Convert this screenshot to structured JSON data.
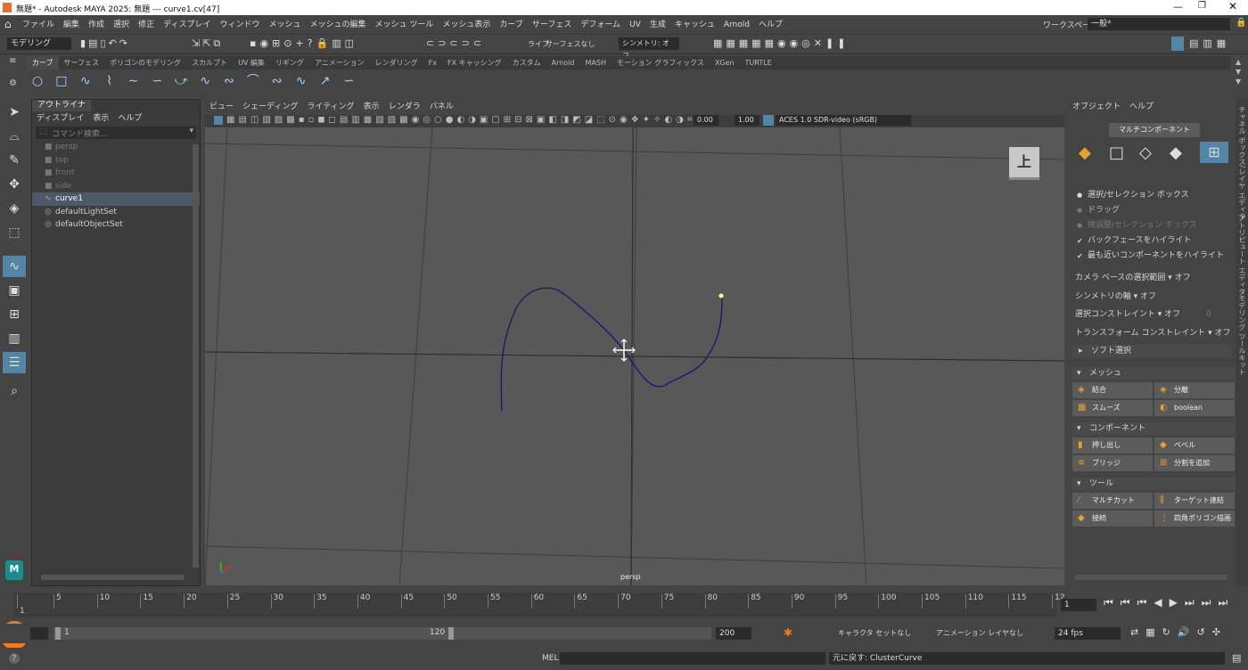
{
  "title_bar": {
    "text": "無題* - Autodesk MAYA 2025: 無題 --- curve1.cv[47]"
  },
  "menu": [
    "ファイル",
    "編集",
    "作成",
    "選択",
    "修正",
    "ディスプレイ",
    "ウィンドウ",
    "メッシュ",
    "メッシュの編集",
    "メッシュ ツール",
    "メッシュ表示",
    "カーブ",
    "サーフェス",
    "デフォーム",
    "UV",
    "生成",
    "キャッシュ",
    "Arnold",
    "ヘルプ"
  ],
  "workspace": {
    "label": "ワークスペース:",
    "value": "一般*"
  },
  "toolbar": {
    "mode_select": "モデリング",
    "live_label": "ライブ",
    "live_value": "サーフェスなし",
    "symmetry": "シンメトリ: オフ"
  },
  "shelf_tabs": [
    "カーブ",
    "サーフェス",
    "ポリゴンのモデリング",
    "スカルプト",
    "UV 編集",
    "リギング",
    "アニメーション",
    "レンダリング",
    "Fx",
    "FX キャッシング",
    "カスタム",
    "Arnold",
    "MASH",
    "モーション グラフィックス",
    "XGen",
    "TURTLE"
  ],
  "outliner": {
    "tab": "アウトライナ",
    "menu": [
      "ディスプレイ",
      "表示",
      "ヘルプ"
    ],
    "search_placeholder": "コマンド検索...",
    "items": [
      "persp",
      "top",
      "front",
      "side",
      "curve1",
      "defaultLightSet",
      "defaultObjectSet"
    ]
  },
  "viewport": {
    "menu": [
      "ビュー",
      "シェーディング",
      "ライティング",
      "表示",
      "レンダラ",
      "パネル"
    ],
    "exposure": "0.00",
    "gamma": "1.00",
    "color_space": "ACES 1.0 SDR-video (sRGB)",
    "camera_label": "persp",
    "viewcube_label": "上"
  },
  "right_panel": {
    "menu": [
      "オブジェクト",
      "ヘルプ"
    ],
    "multi_component": "マルチコンポーネント",
    "select_opts": [
      "選択/セレクション ボックス",
      "ドラッグ",
      "微調整/セレクション ボックス"
    ],
    "checks": [
      "バックフェースをハイライト",
      "最も近いコンポーネントをハイライト"
    ],
    "settings": [
      {
        "label": "カメラ ベースの選択範囲",
        "value": "オフ"
      },
      {
        "label": "シンメトリの軸",
        "value": "オフ"
      },
      {
        "label": "選択コンストレイント",
        "value": "オフ",
        "extra": "0"
      },
      {
        "label": "トランスフォーム コンストレイント",
        "value": "オフ"
      }
    ],
    "soft_select": "ソフト選択",
    "sections": [
      {
        "title": "メッシュ",
        "buttons": [
          "結合",
          "分離",
          "スムーズ",
          "boolean"
        ]
      },
      {
        "title": "コンポーネント",
        "buttons": [
          "押し出し",
          "ベベル",
          "ブリッジ",
          "分割を追加"
        ]
      },
      {
        "title": "ツール",
        "buttons": [
          "マルチカット",
          "ターゲット連結",
          "接続",
          "四角ポリゴン描画"
        ]
      }
    ]
  },
  "side_tabs": [
    "チャネル ボックス/レイヤ エディタ",
    "アトリビュート エディタ",
    "モデリング ツールキット"
  ],
  "timeline": {
    "ticks": [
      "1",
      "5",
      "10",
      "15",
      "20",
      "25",
      "30",
      "35",
      "40",
      "45",
      "50",
      "55",
      "60",
      "65",
      "70",
      "75",
      "80",
      "85",
      "90",
      "95",
      "100",
      "105",
      "110",
      "115",
      "12"
    ],
    "current_frame": "1"
  },
  "range": {
    "start": "1",
    "end": "120",
    "max_end": "200",
    "char_set": "キャラクタ セットなし",
    "anim_layer": "アニメーション レイヤなし",
    "fps": "24 fps"
  },
  "command": {
    "lang": "MEL",
    "result": "元に戻す: ClusterCurve"
  },
  "colors": {
    "accent": "#5285a6",
    "curve": "#1a1a6e",
    "viewport_bg": "#585858"
  }
}
